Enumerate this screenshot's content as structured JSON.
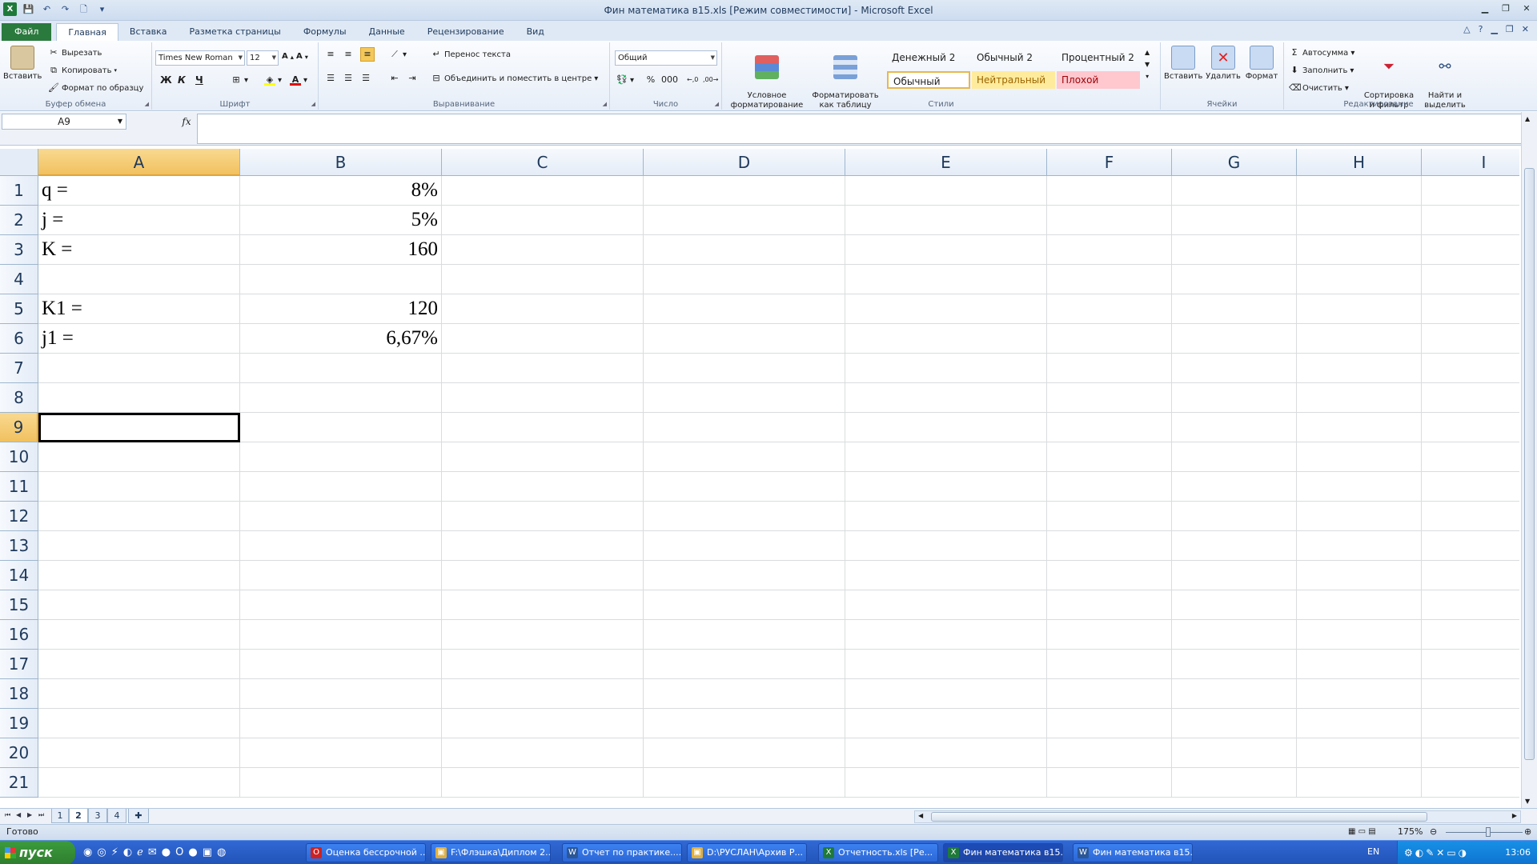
{
  "window": {
    "title": "Фин математика в15.xls  [Режим совместимости]  -  Microsoft Excel"
  },
  "qat": {
    "excel": "X",
    "save": "💾",
    "undo": "↶",
    "redo": "↷",
    "preview": "🗋"
  },
  "tabs": {
    "file": "Файл",
    "home": "Главная",
    "insert": "Вставка",
    "layout": "Разметка страницы",
    "formulas": "Формулы",
    "data": "Данные",
    "review": "Рецензирование",
    "view": "Вид"
  },
  "ribbon": {
    "clipboard": {
      "title": "Буфер обмена",
      "paste": "Вставить",
      "cut": "Вырезать",
      "copy": "Копировать",
      "format_painter": "Формат по образцу"
    },
    "font": {
      "title": "Шрифт",
      "name": "Times New Roman",
      "size": "12",
      "bold": "Ж",
      "italic": "К",
      "underline": "Ч"
    },
    "alignment": {
      "title": "Выравнивание",
      "wrap": "Перенос текста",
      "merge": "Объединить и поместить в центре"
    },
    "number": {
      "title": "Число",
      "format": "Общий"
    },
    "styles": {
      "title": "Стили",
      "conditional": "Условное\nформатирование",
      "as_table": "Форматировать\nкак таблицу",
      "s1": "Денежный 2",
      "s2": "Обычный 2",
      "s3": "Процентный 2",
      "s4": "Обычный",
      "s5": "Нейтральный",
      "s6": "Плохой"
    },
    "cells": {
      "title": "Ячейки",
      "insert": "Вставить",
      "delete": "Удалить",
      "format": "Формат"
    },
    "editing": {
      "title": "Редактирование",
      "autosum": "Автосумма",
      "fill": "Заполнить",
      "clear": "Очистить",
      "sort": "Сортировка\nи фильтр",
      "find": "Найти и\nвыделить"
    }
  },
  "formula_bar": {
    "name_box": "A9",
    "fx": "fx",
    "value": ""
  },
  "columns": [
    "A",
    "B",
    "C",
    "D",
    "E",
    "F",
    "G",
    "H",
    "I"
  ],
  "rows": [
    "1",
    "2",
    "3",
    "4",
    "5",
    "6",
    "7",
    "8",
    "9",
    "10",
    "11",
    "12",
    "13",
    "14",
    "15",
    "16",
    "17",
    "18",
    "19",
    "20",
    "21"
  ],
  "cells": {
    "A1": "q =",
    "B1": "8%",
    "A2": "j =",
    "B2": "5%",
    "A3": "K =",
    "B3": "160",
    "A5": "K1 =",
    "B5": "120",
    "A6": "j1 =",
    "B6": "6,67%"
  },
  "sheets": [
    "1",
    "2",
    "3",
    "4"
  ],
  "status": {
    "ready": "Готово",
    "zoom": "175%"
  },
  "taskbar": {
    "start": "пуск",
    "items": [
      "Оценка бессрочной ...",
      "F:\\Флэшка\\Диплом 2...",
      "Отчет по практике....",
      "D:\\РУСЛАН\\Архив Р...",
      "Отчетность.xls  [Ре...",
      "Фин математика в15....",
      "Фин математика в15...."
    ],
    "lang": "EN",
    "clock": "13:06"
  },
  "colors": {
    "accent": "#2a7a3e",
    "selected_header": "#f1c15f",
    "taskbar": "#2154b8"
  }
}
